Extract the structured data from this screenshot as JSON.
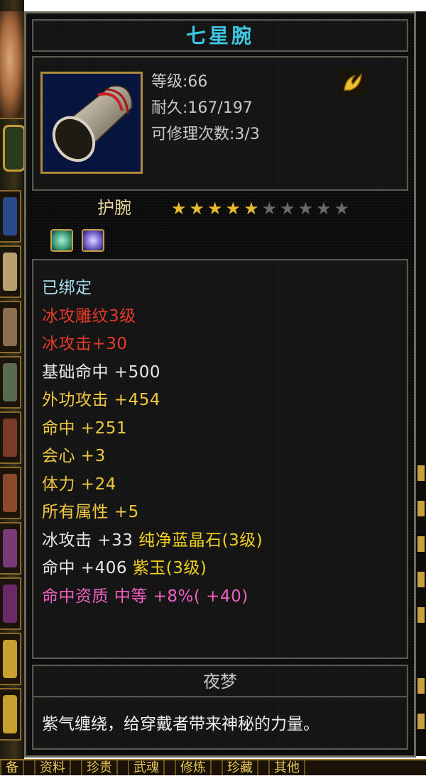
{
  "item": {
    "name": "七星腕",
    "level": "等级:66",
    "durability": "耐久:167/197",
    "repair_count": "可修理次数:3/3",
    "type": "护腕",
    "stars_filled": 5,
    "stars_total": 10,
    "gems": [
      "gem-green-icon",
      "gem-purple-icon"
    ],
    "attributes": [
      {
        "text": "已绑定",
        "color": "bound"
      },
      {
        "text": "冰攻雕纹3级",
        "color": "red"
      },
      {
        "text": "冰攻击+30",
        "color": "red"
      },
      {
        "text": "基础命中  +500",
        "color": "white"
      },
      {
        "text": "外功攻击  +454",
        "color": "yellow"
      },
      {
        "text": "命中  +251",
        "color": "yellow"
      },
      {
        "text": "会心  +3",
        "color": "yellow"
      },
      {
        "text": "体力  +24",
        "color": "yellow"
      },
      {
        "text": "所有属性  +5",
        "color": "yellow"
      }
    ],
    "gem_lines": [
      {
        "stat": "冰攻击  +33  ",
        "gem": "纯净蓝晶石(3级)"
      },
      {
        "stat": "命中  +406  ",
        "gem": "紫玉(3级)"
      }
    ],
    "aptitude": "命中资质   中等  +8%( +40)",
    "maker": "夜梦",
    "description": "紫气缠绕，给穿戴者带来神秘的力量。"
  },
  "bottom_tabs": [
    "备",
    "资料",
    "珍贵",
    "武魂",
    "修炼",
    "珍藏",
    "其他"
  ],
  "colors": {
    "title": "#3ec6e0",
    "bound": "#a8e0f0",
    "red": "#e43a2a",
    "white": "#e8e8e8",
    "yellow": "#f0c840",
    "pink": "#f060c0",
    "star_on": "#e8b830",
    "star_off": "#6a6a6a"
  }
}
